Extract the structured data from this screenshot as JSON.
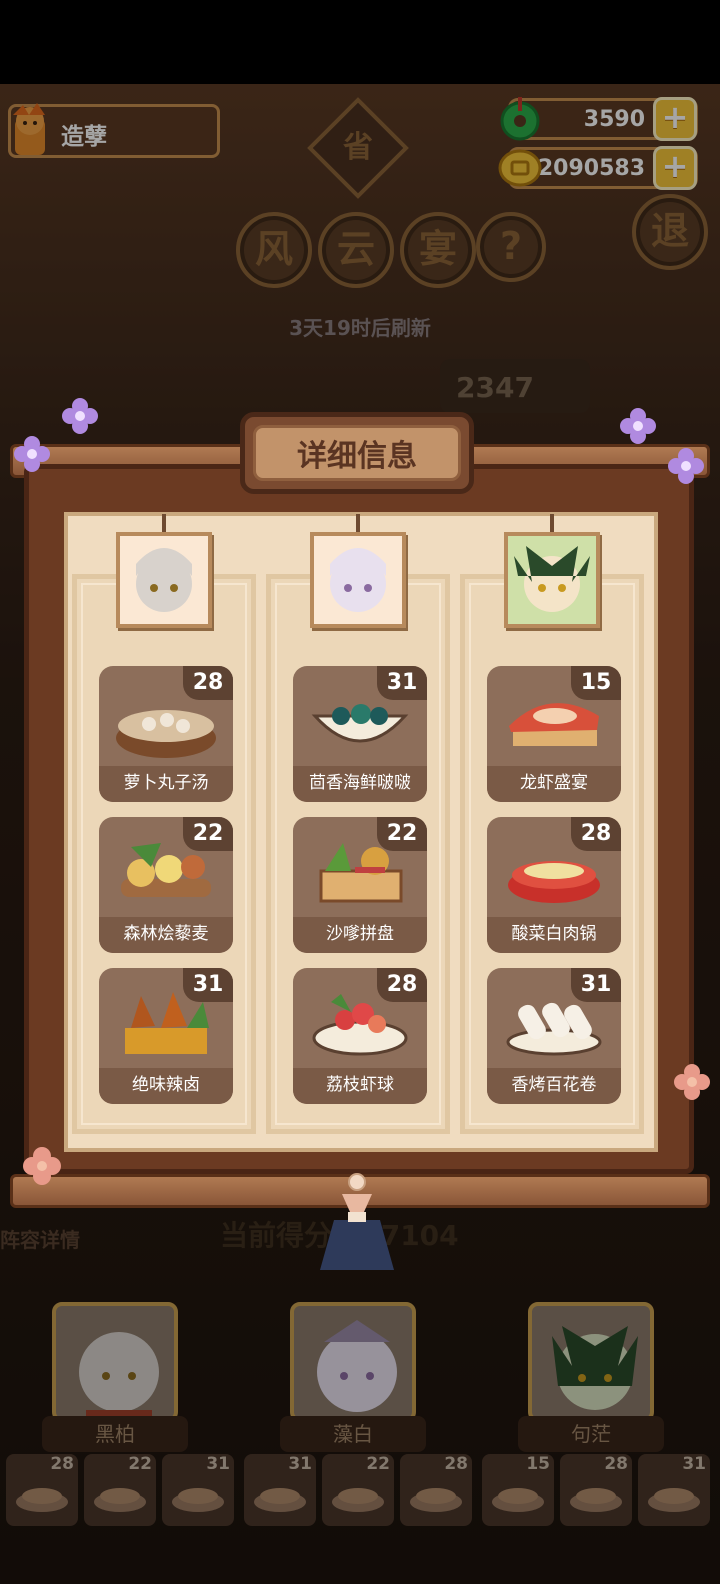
{
  "player": {
    "name": "造孽"
  },
  "resources": {
    "jade": "3590",
    "coins": "2090583",
    "plus": "+"
  },
  "event": {
    "sign": "省",
    "title_chars": [
      "风",
      "云",
      "宴"
    ],
    "help": "?",
    "exit": "退",
    "refresh": "3天19时后刷新",
    "score_partial": "2347"
  },
  "panel": {
    "title": "详细信息",
    "columns": [
      {
        "dishes": [
          {
            "name": "萝卜丸子汤",
            "count": "28"
          },
          {
            "name": "森林烩藜麦",
            "count": "22"
          },
          {
            "name": "绝味辣卤",
            "count": "31"
          }
        ]
      },
      {
        "dishes": [
          {
            "name": "茴香海鲜啵啵",
            "count": "31"
          },
          {
            "name": "沙嗲拼盘",
            "count": "22"
          },
          {
            "name": "荔枝虾球",
            "count": "28"
          }
        ]
      },
      {
        "dishes": [
          {
            "name": "龙虾盛宴",
            "count": "15"
          },
          {
            "name": "酸菜白肉锅",
            "count": "28"
          },
          {
            "name": "香烤百花卷",
            "count": "31"
          }
        ]
      }
    ]
  },
  "bottom": {
    "team_label": "阵容详情",
    "current_score": "当前得分  107104",
    "heroes": [
      "黑柏",
      "藻白",
      "句茫"
    ],
    "slots": [
      "28",
      "22",
      "31",
      "31",
      "22",
      "28",
      "15",
      "28",
      "31"
    ]
  },
  "colors": {
    "accent": "#f5c53a",
    "frame": "#6b3a22",
    "parchment": "#f0dcc0",
    "card": "#8d6e5a"
  }
}
